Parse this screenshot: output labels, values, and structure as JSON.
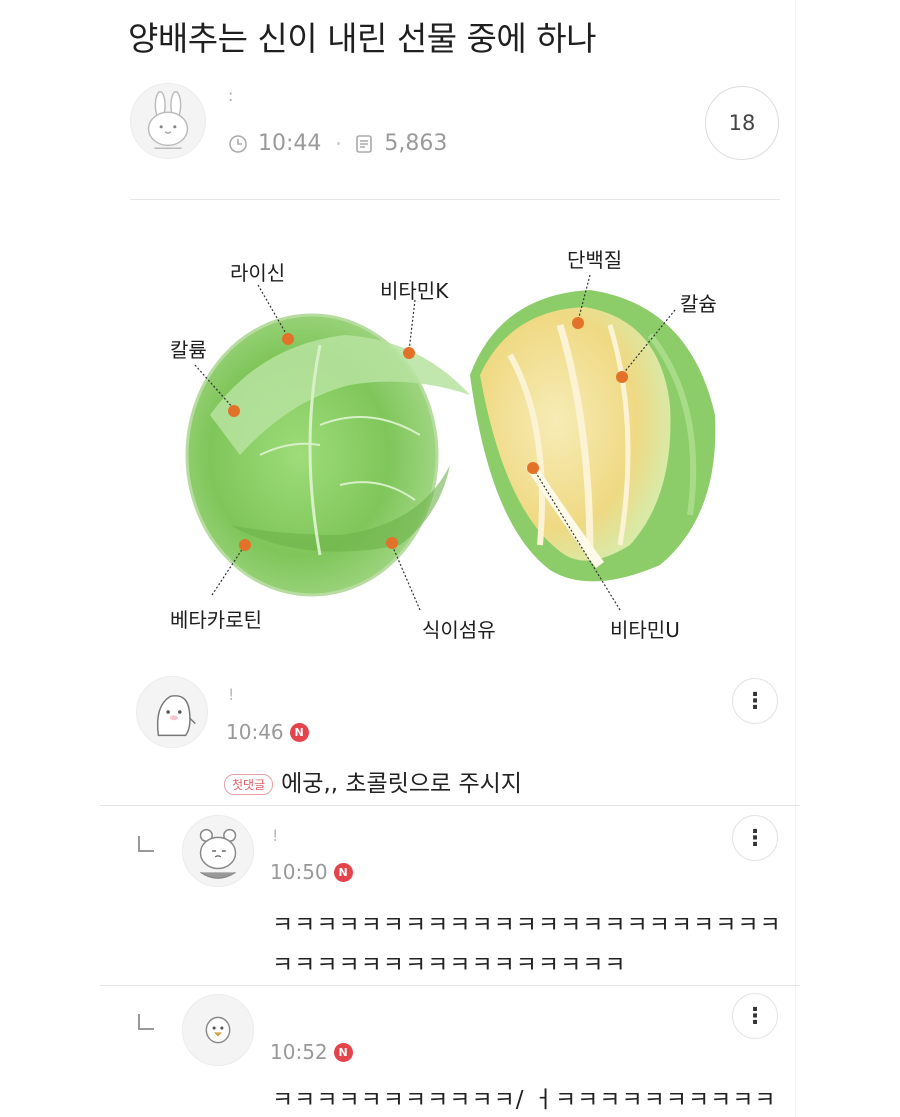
{
  "post": {
    "title": "양배추는 신이 내린 선물 중에 하나",
    "author_name": ":",
    "time": "10:44",
    "views": "5,863",
    "comment_count": "18"
  },
  "figure": {
    "labels": {
      "lysine": "라이신",
      "vitamin_k": "비타민K",
      "protein": "단백질",
      "calcium_left": "칼륨",
      "calcium_right": "칼슘",
      "beta_carotene": "베타카로틴",
      "fiber": "식이섬유",
      "vitamin_u": "비타민U"
    }
  },
  "comments": [
    {
      "name": "!",
      "time": "10:46",
      "new_badge": "N",
      "first_badge": "첫댓글",
      "text": "에궁,, 초콜릿으로 주시지",
      "more": "⋮"
    },
    {
      "name": "!",
      "time": "10:50",
      "new_badge": "N",
      "line1": "ㅋㅋㅋㅋㅋㅋㅋㅋㅋㅋㅋㅋㅋㅋㅋㅋㅋㅋㅋㅋㅋㅋㅋ",
      "line2": "ㅋㅋㅋㅋㅋㅋㅋㅋㅋㅋㅋㅋㅋㅋㅋㅋ",
      "more": "⋮"
    },
    {
      "name": "",
      "time": "10:52",
      "new_badge": "N",
      "line1": "ㅋㅋㅋㅋㅋㅋㅋㅋㅋㅋㅋ/ ㅓㅋㅋㅋㅋㅋㅋㅋㅋㅋㅋ",
      "more": "⋮"
    }
  ],
  "colors": {
    "accent_red": "#e4444c",
    "cabbage_green": "#8fcf6e",
    "cabbage_inner": "#f3e39a",
    "dot_orange": "#e2722a"
  }
}
